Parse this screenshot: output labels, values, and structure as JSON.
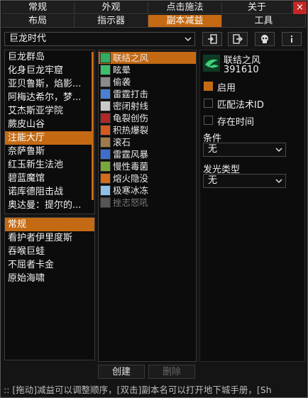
{
  "tabs_row1": [
    {
      "label": "常规",
      "active": false
    },
    {
      "label": "外观",
      "active": false
    },
    {
      "label": "点击施法",
      "active": false
    },
    {
      "label": "关于",
      "active": false
    }
  ],
  "tabs_row2": [
    {
      "label": "布局",
      "active": false
    },
    {
      "label": "指示器",
      "active": false
    },
    {
      "label": "副本减益",
      "active": true
    },
    {
      "label": "工具",
      "active": false
    }
  ],
  "close_label": "×",
  "expansion_select": {
    "value": "巨龙时代"
  },
  "dungeons": [
    "巨龙群岛",
    "化身巨龙牢窟",
    "亚贝鲁斯，焰影...",
    "阿梅达希尔，梦...",
    "艾杰斯亚学院",
    "蕨皮山谷",
    "注能大厅",
    "奈萨鲁斯",
    "红玉新生法池",
    "碧蓝魔馆",
    "诺库德阻击战",
    "奥达曼：提尔的..."
  ],
  "dungeons_selected": 6,
  "bosses": [
    "常规",
    "看护者伊里度斯",
    "吞喉巨蛙",
    "不屈者卡金",
    "原始海啸"
  ],
  "bosses_selected": 0,
  "spells": [
    {
      "name": "联结之风",
      "color": "#2fae62",
      "sel": true,
      "dim": false
    },
    {
      "name": "眩晕",
      "color": "#3cbf6a",
      "sel": false,
      "dim": false
    },
    {
      "name": "偷袭",
      "color": "#8a8a8a",
      "sel": false,
      "dim": false
    },
    {
      "name": "雷霆打击",
      "color": "#4a7fd4",
      "sel": false,
      "dim": false
    },
    {
      "name": "密闭射线",
      "color": "#c9c9c9",
      "sel": false,
      "dim": false
    },
    {
      "name": "龟裂创伤",
      "color": "#b02828",
      "sel": false,
      "dim": false
    },
    {
      "name": "积热爆裂",
      "color": "#d55a1e",
      "sel": false,
      "dim": false
    },
    {
      "name": "滚石",
      "color": "#a07a4a",
      "sel": false,
      "dim": false
    },
    {
      "name": "雷霆风暴",
      "color": "#3e6fd0",
      "sel": false,
      "dim": false
    },
    {
      "name": "慢性毒菌",
      "color": "#7aa83a",
      "sel": false,
      "dim": false
    },
    {
      "name": "熔火隐没",
      "color": "#d46a1a",
      "sel": false,
      "dim": false
    },
    {
      "name": "极寒冰冻",
      "color": "#8fc0e8",
      "sel": false,
      "dim": false
    },
    {
      "name": "挫志怒吼",
      "color": "#555555",
      "sel": false,
      "dim": true
    }
  ],
  "create_label": "创建",
  "delete_label": "删除",
  "detail": {
    "name": "联结之风",
    "id": "391610",
    "enable_label": "启用",
    "enable_checked": true,
    "match_label": "匹配法术ID",
    "match_checked": false,
    "time_label": "存在时间",
    "time_checked": false,
    "condition_label": "条件",
    "condition_value": "无",
    "glow_label": "发光类型",
    "glow_value": "无"
  },
  "status_text": ":: [拖动]减益可以调整顺序，[双击]副本名可以打开地下城手册，[Sh",
  "colors": {
    "accent": "#c46a14",
    "close": "#c42727"
  }
}
